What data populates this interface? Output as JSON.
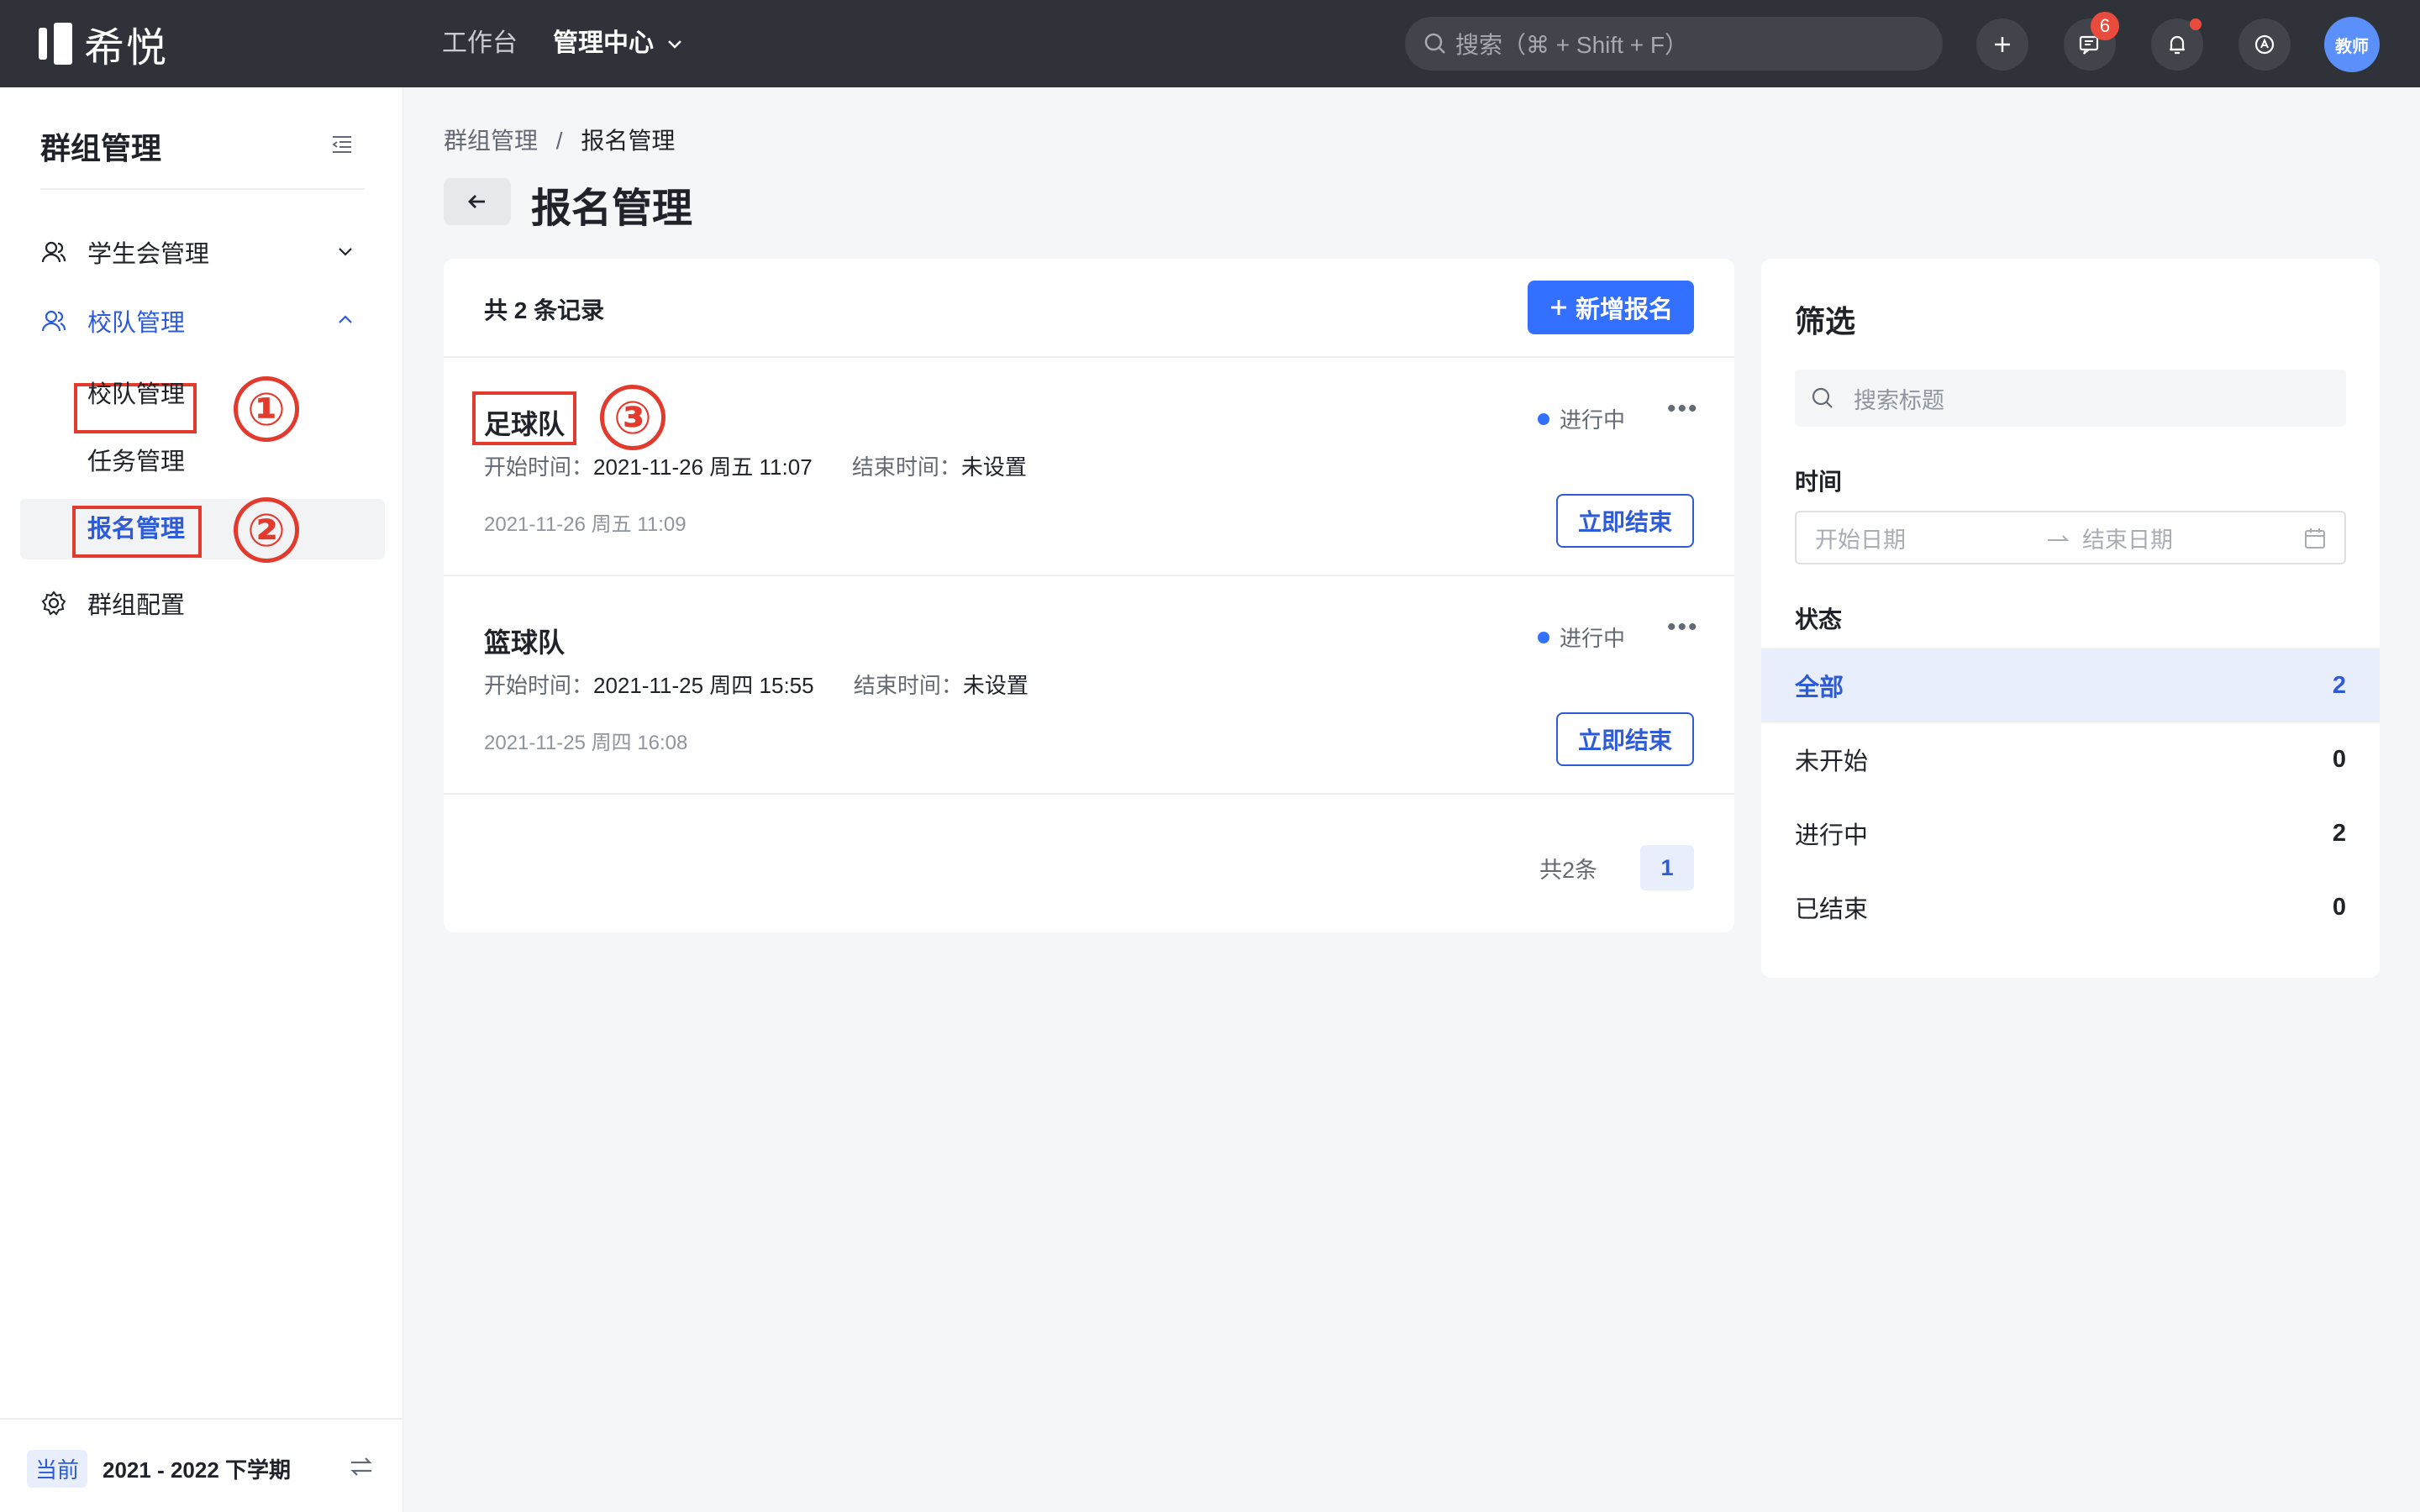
{
  "topbar": {
    "logo_text": "希悦",
    "nav_workbench": "工作台",
    "nav_admin": "管理中心",
    "search_placeholder": "搜索（⌘ + Shift + F）",
    "msg_badge": "6",
    "avatar_text": "教师"
  },
  "sidebar": {
    "title": "群组管理",
    "items": [
      {
        "label": "学生会管理"
      },
      {
        "label": "校队管理"
      },
      {
        "label": "校队管理"
      },
      {
        "label": "任务管理"
      },
      {
        "label": "报名管理"
      },
      {
        "label": "群组配置"
      }
    ],
    "term_tag": "当前",
    "term_value": "2021 - 2022 下学期"
  },
  "annotations": [
    "①",
    "②",
    "③"
  ],
  "main": {
    "breadcrumb_root": "群组管理",
    "breadcrumb_sep": "/",
    "breadcrumb_current": "报名管理",
    "page_title": "报名管理",
    "record_count": "共 2 条记录",
    "add_button": "新增报名",
    "items": [
      {
        "title": "足球队",
        "status": "进行中",
        "start_label": "开始时间：",
        "start_value": "2021-11-26 周五 11:07",
        "end_label": "结束时间：",
        "end_value": "未设置",
        "created": "2021-11-26 周五 11:09",
        "action": "立即结束"
      },
      {
        "title": "篮球队",
        "status": "进行中",
        "start_label": "开始时间：",
        "start_value": "2021-11-25 周四 15:55",
        "end_label": "结束时间：",
        "end_value": "未设置",
        "created": "2021-11-25 周四 16:08",
        "action": "立即结束"
      }
    ],
    "pager_total": "共2条",
    "pager_page": "1"
  },
  "filter": {
    "title": "筛选",
    "search_placeholder": "搜索标题",
    "time_label": "时间",
    "start_placeholder": "开始日期",
    "end_placeholder": "结束日期",
    "status_label": "状态",
    "statuses": [
      {
        "label": "全部",
        "count": "2"
      },
      {
        "label": "未开始",
        "count": "0"
      },
      {
        "label": "进行中",
        "count": "2"
      },
      {
        "label": "已结束",
        "count": "0"
      }
    ]
  },
  "colors": {
    "topbar": "#2f3238",
    "accent": "#3370ff",
    "annotation_red": "#e23b2e"
  }
}
